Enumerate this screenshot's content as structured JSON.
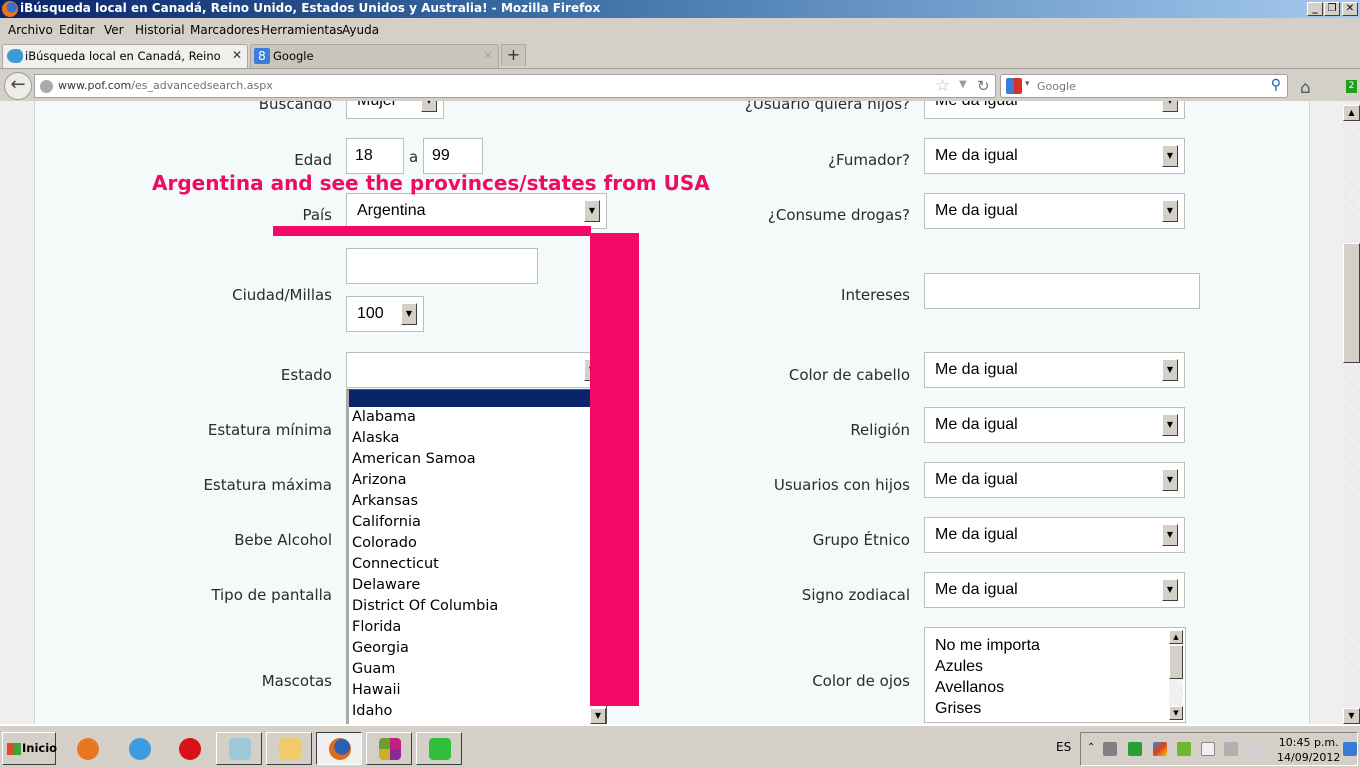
{
  "window": {
    "title": "iBúsqueda local en Canadá, Reino Unido, Estados Unidos y Australia! - Mozilla Firefox",
    "controls": {
      "minimize": "_",
      "restore": "❐",
      "close": "✕"
    }
  },
  "menubar": [
    "Archivo",
    "Editar",
    "Ver",
    "Historial",
    "Marcadores",
    "Herramientas",
    "Ayuda"
  ],
  "tabs": [
    {
      "label": "iBúsqueda local en Canadá, Reino Unido,...",
      "icon": "fish-icon",
      "active": true,
      "close": "✕"
    },
    {
      "label": "Google",
      "icon": "google-icon",
      "active": false,
      "close": "✕"
    }
  ],
  "new_tab": "+",
  "navbar": {
    "back": "←",
    "url_host": "www.pof.com",
    "url_path": "/es_advancedsearch.aspx",
    "star": "☆",
    "dropdown": "▼",
    "reload": "↻",
    "search_placeholder": "Google",
    "search_dropdown": "▾",
    "search_icon": "⚲",
    "home": "⌂",
    "addon_badge": "2"
  },
  "form": {
    "left": {
      "buscando": {
        "label": "Buscando",
        "value": "Mujer"
      },
      "edad": {
        "label": "Edad",
        "from": "18",
        "sep": "a",
        "to": "99"
      },
      "pais": {
        "label": "País",
        "value": "Argentina"
      },
      "ciudad": {
        "label": "Ciudad/Millas",
        "city": "",
        "miles": "100"
      },
      "estado": {
        "label": "Estado",
        "value": ""
      },
      "estatura_min": {
        "label": "Estatura mínima"
      },
      "estatura_max": {
        "label": "Estatura máxima"
      },
      "alcohol": {
        "label": "Bebe Alcohol"
      },
      "pantalla": {
        "label": "Tipo de pantalla"
      },
      "mascotas": {
        "label": "Mascotas"
      }
    },
    "right": {
      "quiere_hijos": {
        "label": "¿Usuario quiera hijos?",
        "value": "Me da igual"
      },
      "fumador": {
        "label": "¿Fumador?",
        "value": "Me da igual"
      },
      "drogas": {
        "label": "¿Consume drogas?",
        "value": "Me da igual"
      },
      "intereses": {
        "label": "Intereses",
        "value": ""
      },
      "cabello": {
        "label": "Color de cabello",
        "value": "Me da igual"
      },
      "religion": {
        "label": "Religión",
        "value": "Me da igual"
      },
      "con_hijos": {
        "label": "Usuarios con hijos",
        "value": "Me da igual"
      },
      "etnico": {
        "label": "Grupo Étnico",
        "value": "Me da igual"
      },
      "zodiaco": {
        "label": "Signo zodiacal",
        "value": "Me da igual"
      },
      "ojos": {
        "label": "Color de ojos",
        "options": [
          "No me importa",
          "Azules",
          "Avellanos",
          "Grises"
        ]
      }
    }
  },
  "estado_dropdown": {
    "options": [
      "Alabama",
      "Alaska",
      "American Samoa",
      "Arizona",
      "Arkansas",
      "California",
      "Colorado",
      "Connecticut",
      "Delaware",
      "District Of Columbia",
      "Florida",
      "Georgia",
      "Guam",
      "Hawaii",
      "Idaho"
    ]
  },
  "annotation": {
    "text": "Argentina and see the provinces/states from USA",
    "color": "#f30a67"
  },
  "taskbar": {
    "start": "Inicio",
    "apps": [
      "media-player-icon",
      "internet-explorer-icon",
      "opera-icon",
      "notepad-icon",
      "file-explorer-icon",
      "firefox-icon",
      "app-grid-icon",
      "paint-icon"
    ],
    "language": "ES",
    "time": "10:45 p.m.",
    "date": "14/09/2012"
  }
}
